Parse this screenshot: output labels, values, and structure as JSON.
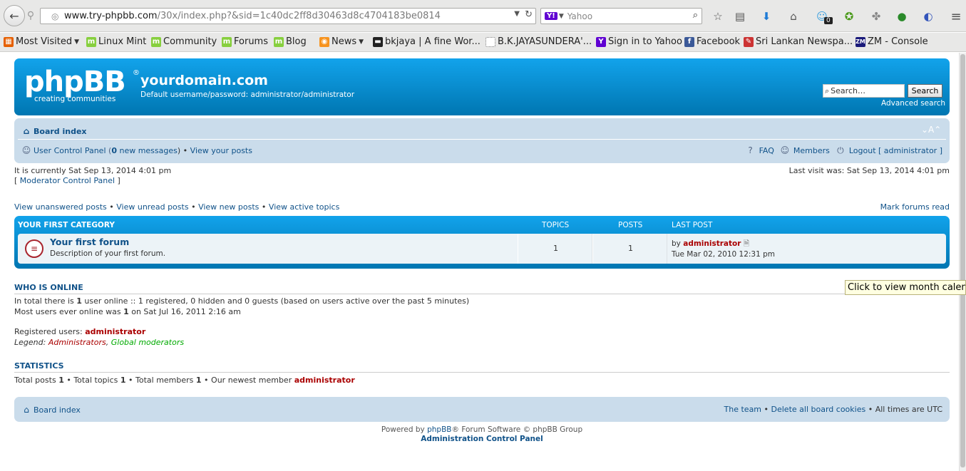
{
  "browser": {
    "url_host": "www.try-phpbb.com",
    "url_path": "/30x/index.php?&sid=1c40dc2ff8d30463d8c4704183be0814",
    "search_engine": "Yahoo",
    "badge_count": "0"
  },
  "bookmarks": [
    {
      "label": "Most Visited",
      "color": "#e66000"
    },
    {
      "label": "Linux Mint",
      "color": "#87cf3e"
    },
    {
      "label": "Community",
      "color": "#87cf3e"
    },
    {
      "label": "Forums",
      "color": "#87cf3e"
    },
    {
      "label": "Blog",
      "color": "#87cf3e"
    },
    {
      "label": "News",
      "color": "#f7931e"
    },
    {
      "label": "bkjaya | A fine Wor...",
      "color": "#222222"
    },
    {
      "label": "B.K.JAYASUNDERA'...",
      "color": "#ffffff"
    },
    {
      "label": "Sign in to Yahoo",
      "color": "#6001d2"
    },
    {
      "label": "Facebook",
      "color": "#3b5998"
    },
    {
      "label": "Sri Lankan Newspa...",
      "color": "#cc3333"
    },
    {
      "label": "ZM - Console",
      "color": "#1a1a7a"
    }
  ],
  "header": {
    "logo_text": "phpBB",
    "logo_tagline": "creating   communities",
    "site_title": "yourdomain.com",
    "site_desc": "Default username/password: administrator/administrator",
    "search_placeholder": "Search…",
    "search_button": "Search",
    "advanced_search": "Advanced search"
  },
  "navbar": {
    "board_index": "Board index",
    "font_size": "⌄A⌃",
    "ucp_label": "User Control Panel",
    "new_messages_count": "0",
    "new_messages_text": "new messages",
    "view_posts": "View your posts",
    "faq": "FAQ",
    "members": "Members",
    "logout": "Logout [ administrator ]"
  },
  "intro": {
    "current_time": "It is currently Sat Sep 13, 2014 4:01 pm",
    "mcp": "Moderator Control Panel",
    "last_visit": "Last visit was: Sat Sep 13, 2014 4:01 pm"
  },
  "quicklinks": [
    "View unanswered posts",
    "View unread posts",
    "View new posts",
    "View active topics"
  ],
  "mark_read": "Mark forums read",
  "category": {
    "name": "YOUR FIRST CATEGORY",
    "col_topics": "TOPICS",
    "col_posts": "POSTS",
    "col_last": "LAST POST",
    "forum": {
      "title": "Your first forum",
      "desc": "Description of your first forum.",
      "topics": "1",
      "posts": "1",
      "last_by": "by",
      "last_user": "administrator",
      "last_date": "Tue Mar 02, 2010 12:31 pm"
    }
  },
  "online": {
    "title": "WHO IS ONLINE",
    "line1_a": "In total there is",
    "line1_n": "1",
    "line1_b": "user online :: 1 registered, 0 hidden and 0 guests (based on users active over the past 5 minutes)",
    "line2_a": "Most users ever online was",
    "line2_n": "1",
    "line2_b": "on Sat Jul 16, 2011 2:16 am",
    "registered_label": "Registered users:",
    "registered_user": "administrator",
    "legend_label": "Legend:",
    "legend_admins": "Administrators",
    "legend_mods": "Global moderators"
  },
  "stats": {
    "title": "STATISTICS",
    "posts_label": "Total posts",
    "posts": "1",
    "topics_label": "Total topics",
    "topics": "1",
    "members_label": "Total members",
    "members": "1",
    "newest_label": "Our newest member",
    "newest": "administrator"
  },
  "tooltip": "Click to view month calendar",
  "footer": {
    "board_index": "Board index",
    "team": "The team",
    "delete_cookies": "Delete all board cookies",
    "timezone": "All times are UTC",
    "powered_a": "Powered by",
    "powered_link": "phpBB",
    "powered_b": "® Forum Software © phpBB Group",
    "acp": "Administration Control Panel"
  }
}
